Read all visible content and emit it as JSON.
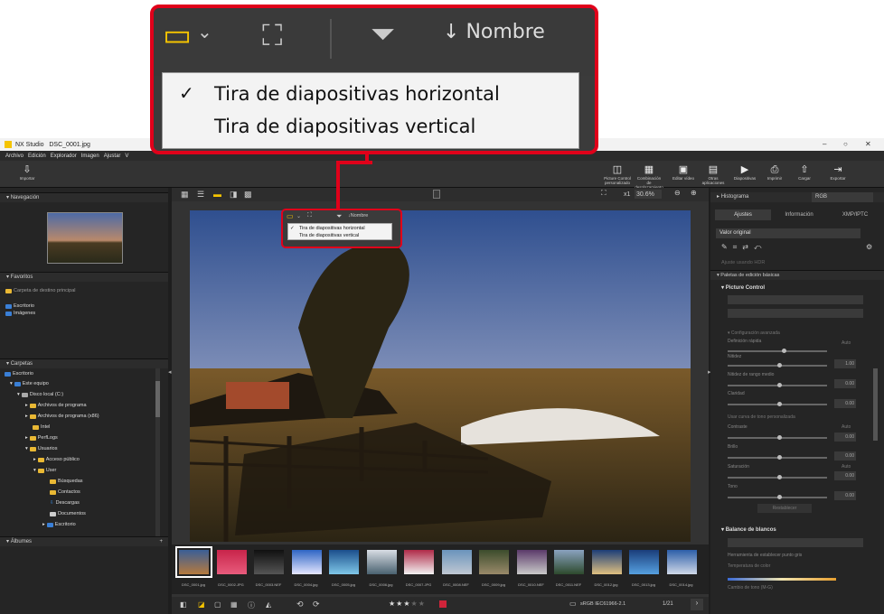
{
  "window": {
    "app": "NX Studio",
    "file": "DSC_0001.jpg"
  },
  "menu": [
    "Archivo",
    "Edición",
    "Explorador",
    "Imagen",
    "Ajustar",
    "V"
  ],
  "toolbar": {
    "import_label": "Importar",
    "right_buttons": [
      {
        "icon": "picture-control-icon",
        "label": "Picture Control personalizado"
      },
      {
        "icon": "pixel-shift-icon",
        "label": "Combinación de desplazamiento de píxel"
      },
      {
        "icon": "edit-video-icon",
        "label": "Editar vídeo"
      },
      {
        "icon": "other-apps-icon",
        "label": "Otras aplicaciones"
      },
      {
        "icon": "slideshow-icon",
        "label": "Diapositivas"
      },
      {
        "icon": "print-icon",
        "label": "Imprimir"
      },
      {
        "icon": "upload-icon",
        "label": "Cargar"
      },
      {
        "icon": "export-icon",
        "label": "Exportar"
      }
    ]
  },
  "left": {
    "nav_title": "Navegación",
    "fav_title": "Favoritos",
    "fav_items": [
      "Carpeta de destino principal",
      "Escritorio",
      "Imágenes"
    ],
    "folders_title": "Carpetas",
    "tree": [
      "Escritorio",
      "Este equipo",
      "Disco local (C:)",
      "Archivos de programa",
      "Archivos de programa (x86)",
      "Intel",
      "PerfLogs",
      "Usuarios",
      "Acceso público",
      "User",
      "Búsquedas",
      "Contactos",
      "Descargas",
      "Documentos",
      "Escritorio"
    ],
    "albums_title": "Álbumes"
  },
  "viewer": {
    "sort_label": "Nombre",
    "zoom_fit": "x1",
    "zoom_pct": "30.6%",
    "layout_menu": [
      "Tira de diapositivas horizontal",
      "Tira de diapositivas vertical"
    ],
    "layout_checked": 0
  },
  "filmstrip": [
    "DSC_0001.jpg",
    "DSC_0002.JPG",
    "DSC_0003.NEF",
    "DSC_0004.jpg",
    "DSC_0005.jpg",
    "DSC_0006.jpg",
    "DSC_0007.JPG",
    "DSC_0008.NEF",
    "DSC_0009.jpg",
    "DSC_0010.NEF",
    "DSC_0011.NEF",
    "DSC_0012.jpg",
    "DSC_0013.jpg",
    "DSC_0014.jpg"
  ],
  "bottom": {
    "color_profile": "sRGB IEC61966-2.1",
    "count": "1/21",
    "rating": 3
  },
  "right": {
    "histogram": "Histograma",
    "histogram_mode": "RGB",
    "tabs": [
      "Ajustes",
      "Información",
      "XMP/IPTC"
    ],
    "preset": "Valor original",
    "hdr": "Ajuste usando HDR",
    "basic": "Paletas de edición básicas",
    "pc": "Picture Control",
    "advanced": "Configuración avanzada",
    "quick": "Definición rápida",
    "auto": "Auto",
    "sliders": [
      {
        "label": "Nitidez",
        "value": "1.00"
      },
      {
        "label": "Nitidez de rango medio",
        "value": "0.00"
      },
      {
        "label": "Claridad",
        "value": "0.00"
      }
    ],
    "tone_curve": "Usar curva de tono personalizada",
    "contrast": "Contraste",
    "contrast_value": "0.00",
    "brightness": "Brillo",
    "brightness_value": "0.00",
    "saturation": "Saturación",
    "saturation_value": "0.00",
    "hue": "Tono",
    "hue_value": "0.00",
    "reset": "Restablecer",
    "wb": "Balance de blancos",
    "gray_tool": "Herramienta de establecer punto gris",
    "temp": "Temperatura de color",
    "tint": "Cambio de tono (M-G)"
  }
}
